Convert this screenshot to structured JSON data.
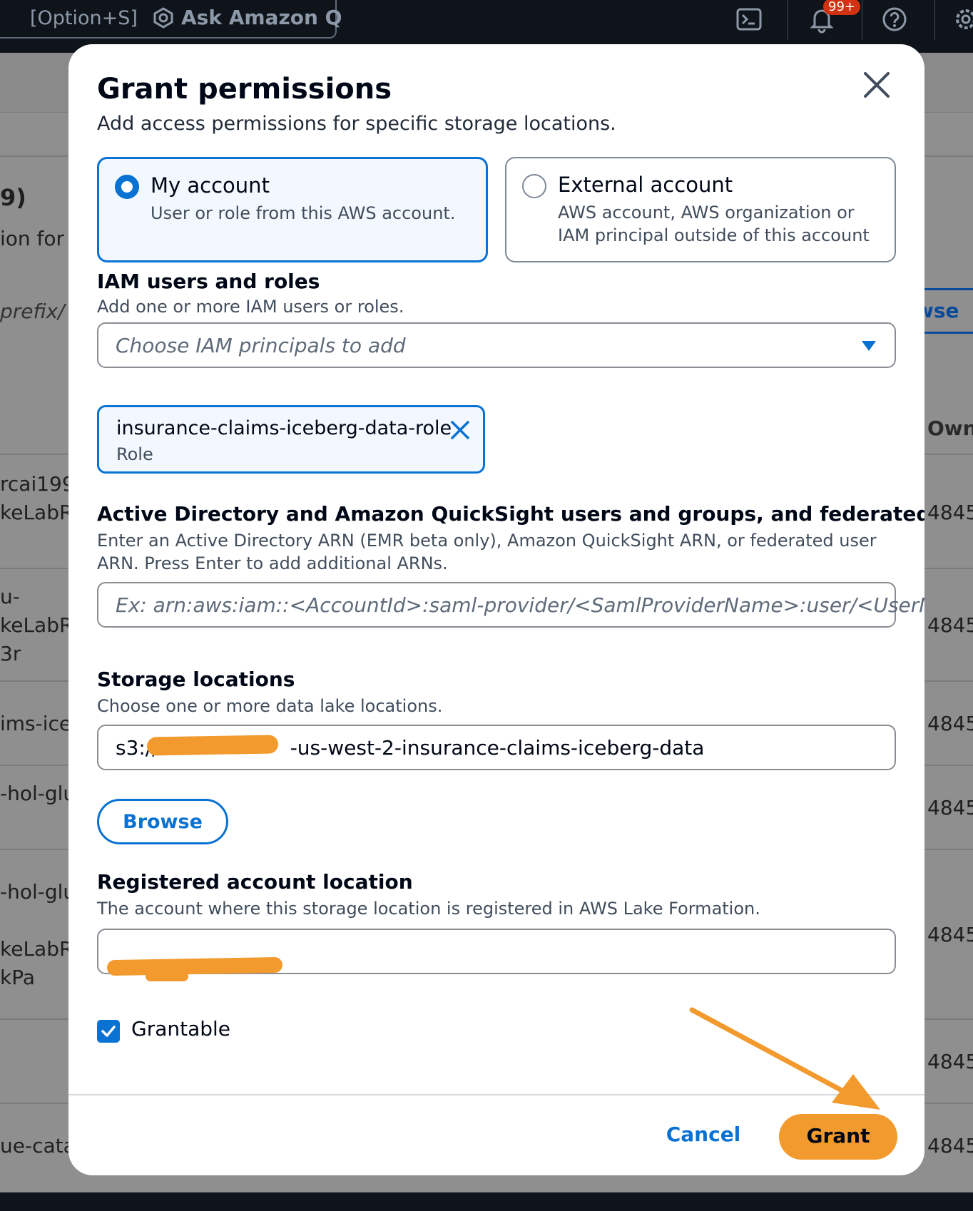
{
  "topbar": {
    "shortcut": "[Option+S]",
    "ask_q": "Ask Amazon Q",
    "notification_badge": "99+"
  },
  "background": {
    "heading_fragment": "9)",
    "desc_fragment": "ion for v",
    "prefix_fragment": "prefix/",
    "browse_fragment": "wse",
    "col_owner": "Own",
    "rows": [
      {
        "left": "rcai199",
        "right": "4845"
      },
      {
        "left": "keLabRo",
        "right": ""
      },
      {
        "left": "u-",
        "right": ""
      },
      {
        "left": "keLabRo",
        "right": "4845"
      },
      {
        "left": "3r",
        "right": ""
      },
      {
        "left": "ims-icel",
        "right": "4845"
      },
      {
        "left": "-hol-glu",
        "right": "4845"
      },
      {
        "left": "-hol-glu",
        "right": ""
      },
      {
        "left": "keLabRo",
        "right": "4845"
      },
      {
        "left": "kPa",
        "right": ""
      },
      {
        "left": "",
        "right": "4845"
      },
      {
        "left": "ue-catal",
        "right": "4845"
      }
    ]
  },
  "modal": {
    "title": "Grant permissions",
    "subtitle": "Add access permissions for specific storage locations.",
    "account_options": [
      {
        "label": "My account",
        "description": "User or role from this AWS account.",
        "selected": true
      },
      {
        "label": "External account",
        "description": "AWS account, AWS organization or IAM principal outside of this account",
        "selected": false
      }
    ],
    "iam": {
      "heading": "IAM users and roles",
      "description": "Add one or more IAM users or roles.",
      "placeholder": "Choose IAM principals to add",
      "token_name": "insurance-claims-iceberg-data-role",
      "token_type": "Role"
    },
    "ad": {
      "heading": "Active Directory and Amazon QuickSight users and groups, and federated users",
      "description": "Enter an Active Directory ARN (EMR beta only), Amazon QuickSight ARN, or federated user ARN. Press Enter to add additional ARNs.",
      "placeholder": "Ex: arn:aws:iam::<AccountId>:saml-provider/<SamlProviderName>:user/<UserName>"
    },
    "storage": {
      "heading": "Storage locations",
      "description": "Choose one or more data lake locations.",
      "value_prefix": "s3://",
      "value_suffix": "-us-west-2-insurance-claims-iceberg-data",
      "browse_label": "Browse"
    },
    "registered": {
      "heading": "Registered account location",
      "description": "The account where this storage location is registered in AWS Lake Formation."
    },
    "grantable_label": "Grantable",
    "grantable_checked": true,
    "cancel_label": "Cancel",
    "grant_label": "Grant",
    "colors": {
      "accent": "#0972d3",
      "annotation_orange": "#f29a2e"
    }
  }
}
